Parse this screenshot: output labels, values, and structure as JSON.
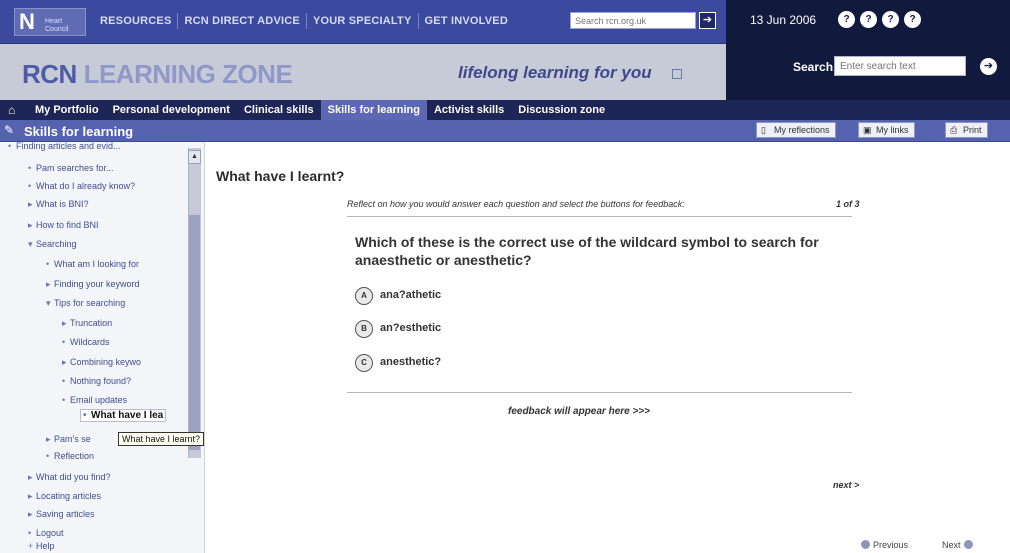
{
  "logo": {
    "letter": "N",
    "small_text": "Heart Council"
  },
  "top_nav": [
    "RESOURCES",
    "RCN DIRECT ADVICE",
    "YOUR SPECIALTY",
    "GET INVOLVED"
  ],
  "top_search": {
    "placeholder": "Search rcn.org.uk",
    "go_symbol": "➔"
  },
  "date": "13 Jun 2006",
  "circle_icons": [
    "?",
    "?",
    "?",
    "?"
  ],
  "brand": {
    "rcn": "RCN ",
    "name": "LEARNING ZONE",
    "tagline": "lifelong learning for you"
  },
  "site_search": {
    "label": "Search",
    "placeholder": "Enter search text",
    "go_symbol": "➔"
  },
  "main_nav": {
    "home_icon": "⌂",
    "items": [
      {
        "label": "My Portfolio"
      },
      {
        "label": "Personal development"
      },
      {
        "label": "Clinical skills"
      },
      {
        "label": "Skills for learning"
      },
      {
        "label": "Activist skills"
      },
      {
        "label": "Discussion zone"
      }
    ],
    "active_index": 3
  },
  "section": {
    "title": "Skills for learning",
    "utility_buttons": [
      {
        "label": "My reflections",
        "icon": "doc-icon"
      },
      {
        "label": "My links",
        "icon": "link-icon"
      },
      {
        "label": "Print",
        "icon": "print-icon"
      }
    ]
  },
  "sidebar": {
    "items": [
      {
        "label": "Finding articles and evid...",
        "bullet": "•"
      },
      {
        "label": "Pam searches for...",
        "bullet": "•"
      },
      {
        "label": "What do I already know?",
        "bullet": "•"
      },
      {
        "label": "What is BNI?",
        "bullet": "▸"
      },
      {
        "label": "How to find BNI",
        "bullet": "▸"
      },
      {
        "label": "Searching",
        "bullet": "▾"
      },
      {
        "label": "What am I looking for",
        "bullet": "•"
      },
      {
        "label": "Finding your keyword",
        "bullet": "▸"
      },
      {
        "label": "Tips for searching",
        "bullet": "▾"
      },
      {
        "label": "Truncation",
        "bullet": "▸"
      },
      {
        "label": "Wildcards",
        "bullet": "•"
      },
      {
        "label": "Combining keywo",
        "bullet": "▸"
      },
      {
        "label": "Nothing found?",
        "bullet": "•"
      },
      {
        "label": "Email updates",
        "bullet": "•"
      },
      {
        "label": "What have I lea",
        "bullet": "•"
      },
      {
        "label": "Pam's se",
        "bullet": "▸"
      },
      {
        "label": "Reflection",
        "bullet": "•"
      },
      {
        "label": "What did you find?",
        "bullet": "▸"
      },
      {
        "label": "Locating articles",
        "bullet": "▸"
      },
      {
        "label": "Saving articles",
        "bullet": "▸"
      },
      {
        "label": "Logout",
        "bullet": "•"
      },
      {
        "label": "Help",
        "bullet": "+"
      }
    ],
    "current_index": 14,
    "tooltip": "What have I learnt?",
    "scroll_up_symbol": "▲"
  },
  "content": {
    "title": "What have I learnt?",
    "instruction": "Reflect on how you would answer each question and select the buttons for feedback:",
    "progress": "1 of 3",
    "question": "Which of these is the correct use of the wildcard symbol to search for anaesthetic or anesthetic?",
    "options": [
      {
        "key": "A",
        "label": "ana?athetic"
      },
      {
        "key": "B",
        "label": "an?esthetic"
      },
      {
        "key": "C",
        "label": "anesthetic?"
      }
    ],
    "feedback": "feedback will appear here >>>",
    "next_link": "next >",
    "pager": {
      "previous": "Previous",
      "next": "Next"
    }
  }
}
